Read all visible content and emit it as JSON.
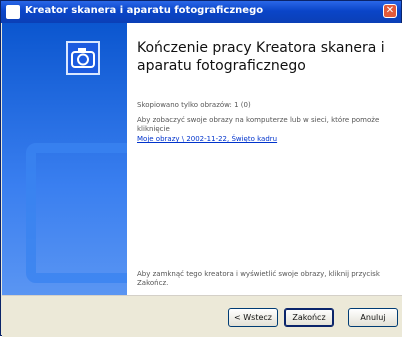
{
  "window": {
    "title": "Kreator skanera i aparatu fotograficznego"
  },
  "content": {
    "heading": "Kończenie pracy Kreatora skanera i aparatu fotograficznego",
    "copied_count": "Skopiowano tylko obrazów: 1 (0)",
    "instruction_line1": "Aby zobaczyć swoje obrazy na komputerze lub w sieci, które pomoże",
    "instruction_line2": "kliknięcie",
    "folder_link": "Moje obrazy \\ 2002-11-22, Święto kadru",
    "finish_note_line1": "Aby zamknąć tego kreatora i wyświetlić swoje obrazy, kliknij przycisk",
    "finish_note_line2": "Zakończ."
  },
  "buttons": {
    "back": "< Wstecz",
    "finish": "Zakończ",
    "cancel": "Anuluj"
  },
  "icons": {
    "title": "camera-icon",
    "logo": "camera-icon"
  },
  "colors": {
    "titlebar": "#0a45c8",
    "sidebar": "#0b56cf",
    "link": "#0033cc"
  }
}
